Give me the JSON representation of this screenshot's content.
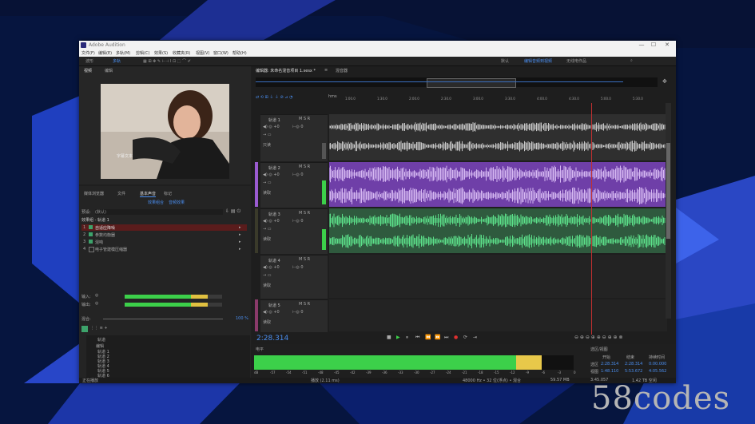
{
  "app": {
    "title": "Adobe Audition",
    "window_controls": [
      "—",
      "☐",
      "✕"
    ]
  },
  "menu": [
    "文件(F)",
    "编辑(E)",
    "多轨(M)",
    "剪辑(C)",
    "效果(S)",
    "收藏夹(R)",
    "视图(V)",
    "窗口(W)",
    "帮助(H)"
  ],
  "toolbar": {
    "left": [
      "波形",
      "多轨"
    ],
    "workspaces": [
      "默认",
      "编辑音频到视频",
      "无线电作品"
    ],
    "workspace_active_index": 1
  },
  "left_panel": {
    "tabs": [
      "视频",
      "编辑"
    ],
    "mid_tabs": [
      "媒体浏览器",
      "文件",
      "基本声音",
      "标记"
    ],
    "sub_tabs": [
      "效果组合",
      "音频效果"
    ],
    "preset_label": "预设:",
    "preset_value": "(默认)",
    "rack_title": "效果组 - 轨道 1",
    "effects": [
      {
        "n": "1",
        "label": "自适应降噪"
      },
      {
        "n": "2",
        "label": "参数均衡器"
      },
      {
        "n": "3",
        "label": "混响"
      },
      {
        "n": "4",
        "label": "电子管建模压缩器"
      }
    ],
    "input_label": "输入:",
    "output_label": "输出:",
    "mix_label": "混合:",
    "mix_value": "100 %",
    "tracks_header": "轨道",
    "track_list": [
      "编辑",
      "轨道 1",
      "轨道 2",
      "轨道 3",
      "轨道 4",
      "轨道 5",
      "轨道 6"
    ]
  },
  "editor": {
    "tab_label": "编辑器: 未命名混音项目 1.sesx *",
    "mixer_tab": "混音器",
    "timeline_unit": "hms",
    "ruler_ticks": [
      "1:00.0",
      "1:30.0",
      "2:00.0",
      "2:30.0",
      "3:00.0",
      "3:30.0",
      "4:00.0",
      "4:30.0",
      "5:00.0",
      "5:30.0"
    ],
    "tracks": [
      {
        "name": "轨道 1",
        "volume": "+0",
        "pan": "0",
        "color": "#b8b8b8",
        "accent": "#5a5a5a",
        "mode": "只读"
      },
      {
        "name": "轨道 2",
        "volume": "+0",
        "pan": "0",
        "color": "#9a5bd0",
        "accent": "#9a5bd0",
        "mode": "读取"
      },
      {
        "name": "轨道 3",
        "volume": "+0",
        "pan": "0",
        "color": "#3da36b",
        "accent": "#3da36b",
        "mode": "读取"
      },
      {
        "name": "轨道 4",
        "volume": "+0",
        "pan": "0",
        "color": "#3a3a3a",
        "accent": "#5a5a5a",
        "mode": "读取"
      },
      {
        "name": "轨道 5",
        "volume": "+0",
        "pan": "0",
        "color": "#3a3a3a",
        "accent": "#8a3a6a",
        "mode": "读取"
      }
    ],
    "time_display": "2:28.314",
    "transport": [
      "■",
      "▶",
      "⏸",
      "⏮",
      "⏪",
      "⏩",
      "⏭",
      "●",
      "⟳",
      "⇥"
    ]
  },
  "levels": {
    "tab_label": "电平",
    "scale": [
      "dB",
      "-57",
      "-54",
      "-51",
      "-48",
      "-45",
      "-42",
      "-39",
      "-36",
      "-33",
      "-30",
      "-27",
      "-24",
      "-21",
      "-18",
      "-15",
      "-12",
      "-9",
      "-6",
      "-3",
      "0"
    ],
    "level_fraction": 0.9
  },
  "selection": {
    "tab_label": "选区/视图",
    "headers": [
      "",
      "开始",
      "结束",
      "持续时间"
    ],
    "rows": [
      [
        "选区",
        "2:28.314",
        "2:28.314",
        "0:00.000"
      ],
      [
        "视图",
        "1:48.110",
        "5:53.672",
        "4:05.562"
      ]
    ]
  },
  "status": {
    "left": "正在播放",
    "center1": "48000 Hz • 32 位(浮点) • 混合",
    "center2": "59.57 MB",
    "center3": "3:45.057",
    "right": "1.42 TB 空闲",
    "mid": "播放 (2.11 ms)"
  },
  "watermark": "58codes"
}
